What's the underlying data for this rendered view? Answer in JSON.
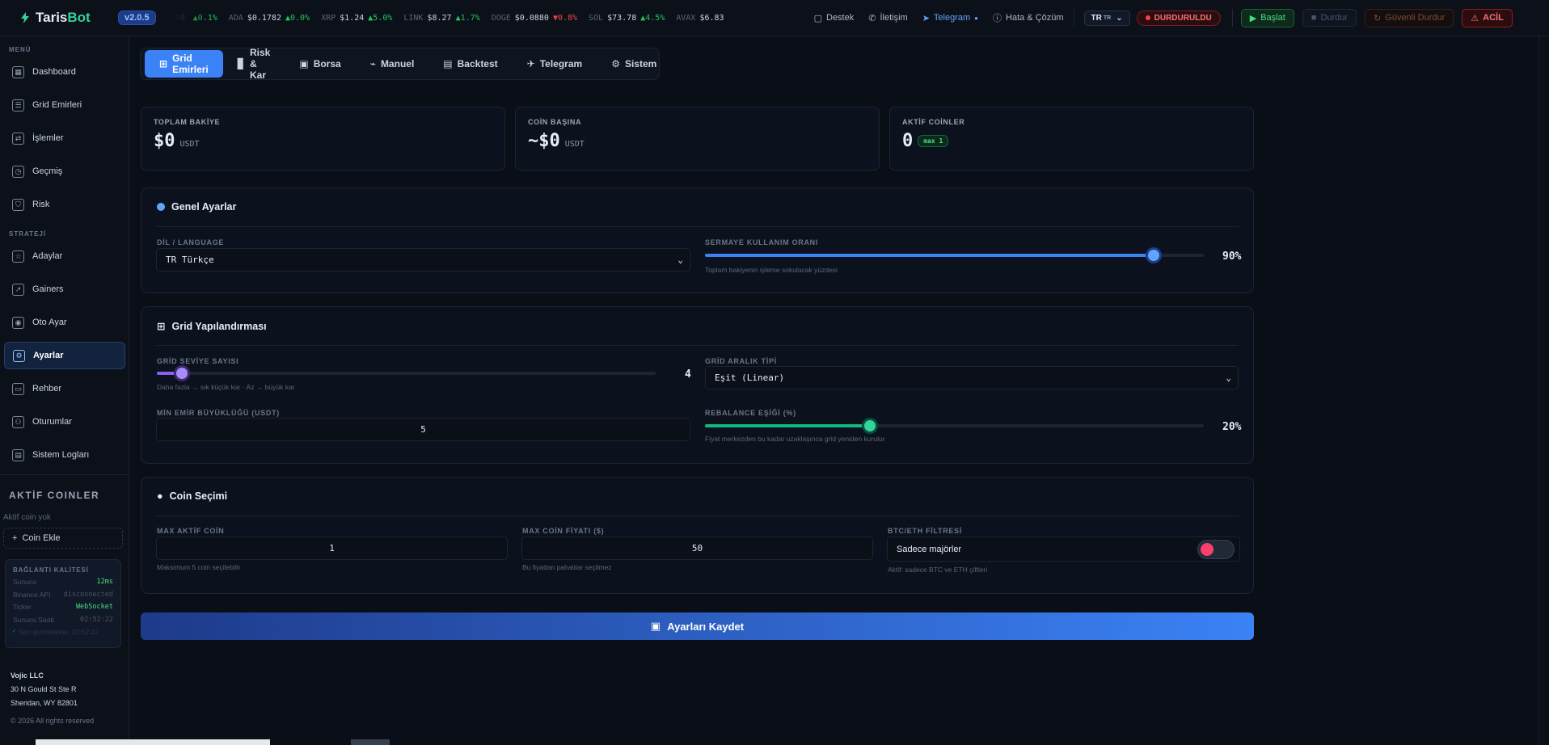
{
  "brand": {
    "name_a": "Taris",
    "name_b": "Bot",
    "version": "v2.0.5"
  },
  "ticker": [
    {
      "sym": ".10",
      "price": "",
      "chg": "▲0.1%",
      "dir": "up"
    },
    {
      "sym": "ADA",
      "price": "$0.1782",
      "chg": "▲0.0%",
      "dir": "up"
    },
    {
      "sym": "XRP",
      "price": "$1.24",
      "chg": "▲5.0%",
      "dir": "up"
    },
    {
      "sym": "LINK",
      "price": "$8.27",
      "chg": "▲1.7%",
      "dir": "up"
    },
    {
      "sym": "DOGE",
      "price": "$0.0880",
      "chg": "▼0.8%",
      "dir": "dn"
    },
    {
      "sym": "SOL",
      "price": "$73.78",
      "chg": "▲4.5%",
      "dir": "up"
    },
    {
      "sym": "AVAX",
      "price": "$6.83",
      "chg": "",
      "dir": "up"
    }
  ],
  "toplinks": {
    "destek": "Destek",
    "iletisim": "İletişim",
    "telegram": "Telegram",
    "hata": "Hata & Çözüm"
  },
  "lang": "TR",
  "lang_small": "TR",
  "status": "DURDURULDU",
  "actions": {
    "start": "Başlat",
    "stop": "Durdur",
    "safe_stop": "Güvenli Durdur",
    "emergency": "ACİL"
  },
  "sidebar": {
    "menu_title": "MENÜ",
    "menu": [
      {
        "label": "Dashboard",
        "icon": "dashboard-icon",
        "glyph": "▦"
      },
      {
        "label": "Grid Emirleri",
        "icon": "list-icon",
        "glyph": "☰"
      },
      {
        "label": "İşlemler",
        "icon": "swap-icon",
        "glyph": "⇄"
      },
      {
        "label": "Geçmiş",
        "icon": "clock-icon",
        "glyph": "◷"
      },
      {
        "label": "Risk",
        "icon": "shield-icon",
        "glyph": "⛉"
      }
    ],
    "strategy_title": "STRATEJİ",
    "strategy": [
      {
        "label": "Adaylar",
        "icon": "star-icon",
        "glyph": "☆"
      },
      {
        "label": "Gainers",
        "icon": "trend-up-icon",
        "glyph": "↗"
      },
      {
        "label": "Oto Ayar",
        "icon": "radio-icon",
        "glyph": "◉"
      },
      {
        "label": "Ayarlar",
        "icon": "gear-icon",
        "glyph": "⚙"
      },
      {
        "label": "Rehber",
        "icon": "book-icon",
        "glyph": "▭"
      },
      {
        "label": "Oturumlar",
        "icon": "users-icon",
        "glyph": "⚇"
      },
      {
        "label": "Sistem Logları",
        "icon": "file-icon",
        "glyph": "▤"
      }
    ],
    "active_coins_title": "AKTİF COINLER",
    "no_active": "Aktif coin yok",
    "add_coin": "Coin Ekle",
    "conn": {
      "title": "BAĞLANTI KALİTESİ",
      "rows": [
        {
          "k": "Sunucu",
          "v": "12ms"
        },
        {
          "k": "Binance API",
          "v": "disconnected"
        },
        {
          "k": "Ticker",
          "v": "WebSocket"
        },
        {
          "k": "Sunucu Saati",
          "v": "02:52:22"
        }
      ],
      "last": "Son güncelleme: 02:52:22"
    },
    "footer": {
      "company": "Vojic LLC",
      "addr1": "30 N Gould St Ste R",
      "addr2": "Sheridan, WY 82801",
      "copy": "© 2026 All rights reserved"
    }
  },
  "tabs": [
    {
      "label": "Grid Emirleri",
      "glyph": "⊞"
    },
    {
      "label": "Risk & Kar",
      "glyph": "▊"
    },
    {
      "label": "Borsa",
      "glyph": "▣"
    },
    {
      "label": "Manuel",
      "glyph": "⌁"
    },
    {
      "label": "Backtest",
      "glyph": "▤"
    },
    {
      "label": "Telegram",
      "glyph": "✈"
    },
    {
      "label": "Sistem",
      "glyph": "⚙"
    }
  ],
  "cards": [
    {
      "label": "TOPLAM BAKİYE",
      "value": "$0",
      "unit": "USDT"
    },
    {
      "label": "COİN BAŞINA",
      "value": "~$0",
      "unit": "USDT"
    },
    {
      "label": "AKTİF COİNLER",
      "value": "0",
      "badge": "max 1"
    }
  ],
  "genel": {
    "title": "Genel Ayarlar",
    "lang_label": "DİL / LANGUAGE",
    "lang_value": "TR Türkçe",
    "capital_label": "SERMAYE KULLANIM ORANI",
    "capital_value": "90%",
    "capital_fraction": 0.9,
    "capital_hint": "Toplam bakiyenin işleme sokulacak yüzdesi"
  },
  "grid": {
    "title": "Grid Yapılandırması",
    "levels_label": "GRİD SEVİYE SAYISI",
    "levels_value": "4",
    "levels_fraction": 0.05,
    "levels_hint": "Daha fazla → sık küçük kar · Az → büyük kar",
    "type_label": "GRİD ARALIK TİPİ",
    "type_value": "Eşit (Linear)",
    "min_label": "MİN EMİR BÜYÜKLÜĞÜ (USDT)",
    "min_value": "5",
    "rebalance_label": "REBALANCE EŞİĞİ (%)",
    "rebalance_value": "20%",
    "rebalance_fraction": 0.33,
    "rebalance_hint": "Fiyat merkezden bu kadar uzaklaşınca grid yeniden kurulur"
  },
  "coin": {
    "title": "Coin Seçimi",
    "max_active_label": "MAX AKTİF COİN",
    "max_active_value": "1",
    "max_active_hint": "Maksimum 5 coin seçilebilir",
    "max_price_label": "MAX COİN FİYATI ($)",
    "max_price_value": "50",
    "max_price_hint": "Bu fiyattan pahalılar seçilmez",
    "filter_label": "BTC/ETH FİLTRESİ",
    "filter_value": "Sadece majörler",
    "filter_hint": "Aktif: sadece BTC ve ETH çiftleri"
  },
  "save_label": "Ayarları Kaydet",
  "colors": {
    "accent": "#3b82f6",
    "green": "#10b981",
    "purple": "#8b5cf6",
    "danger": "#ef4444"
  }
}
